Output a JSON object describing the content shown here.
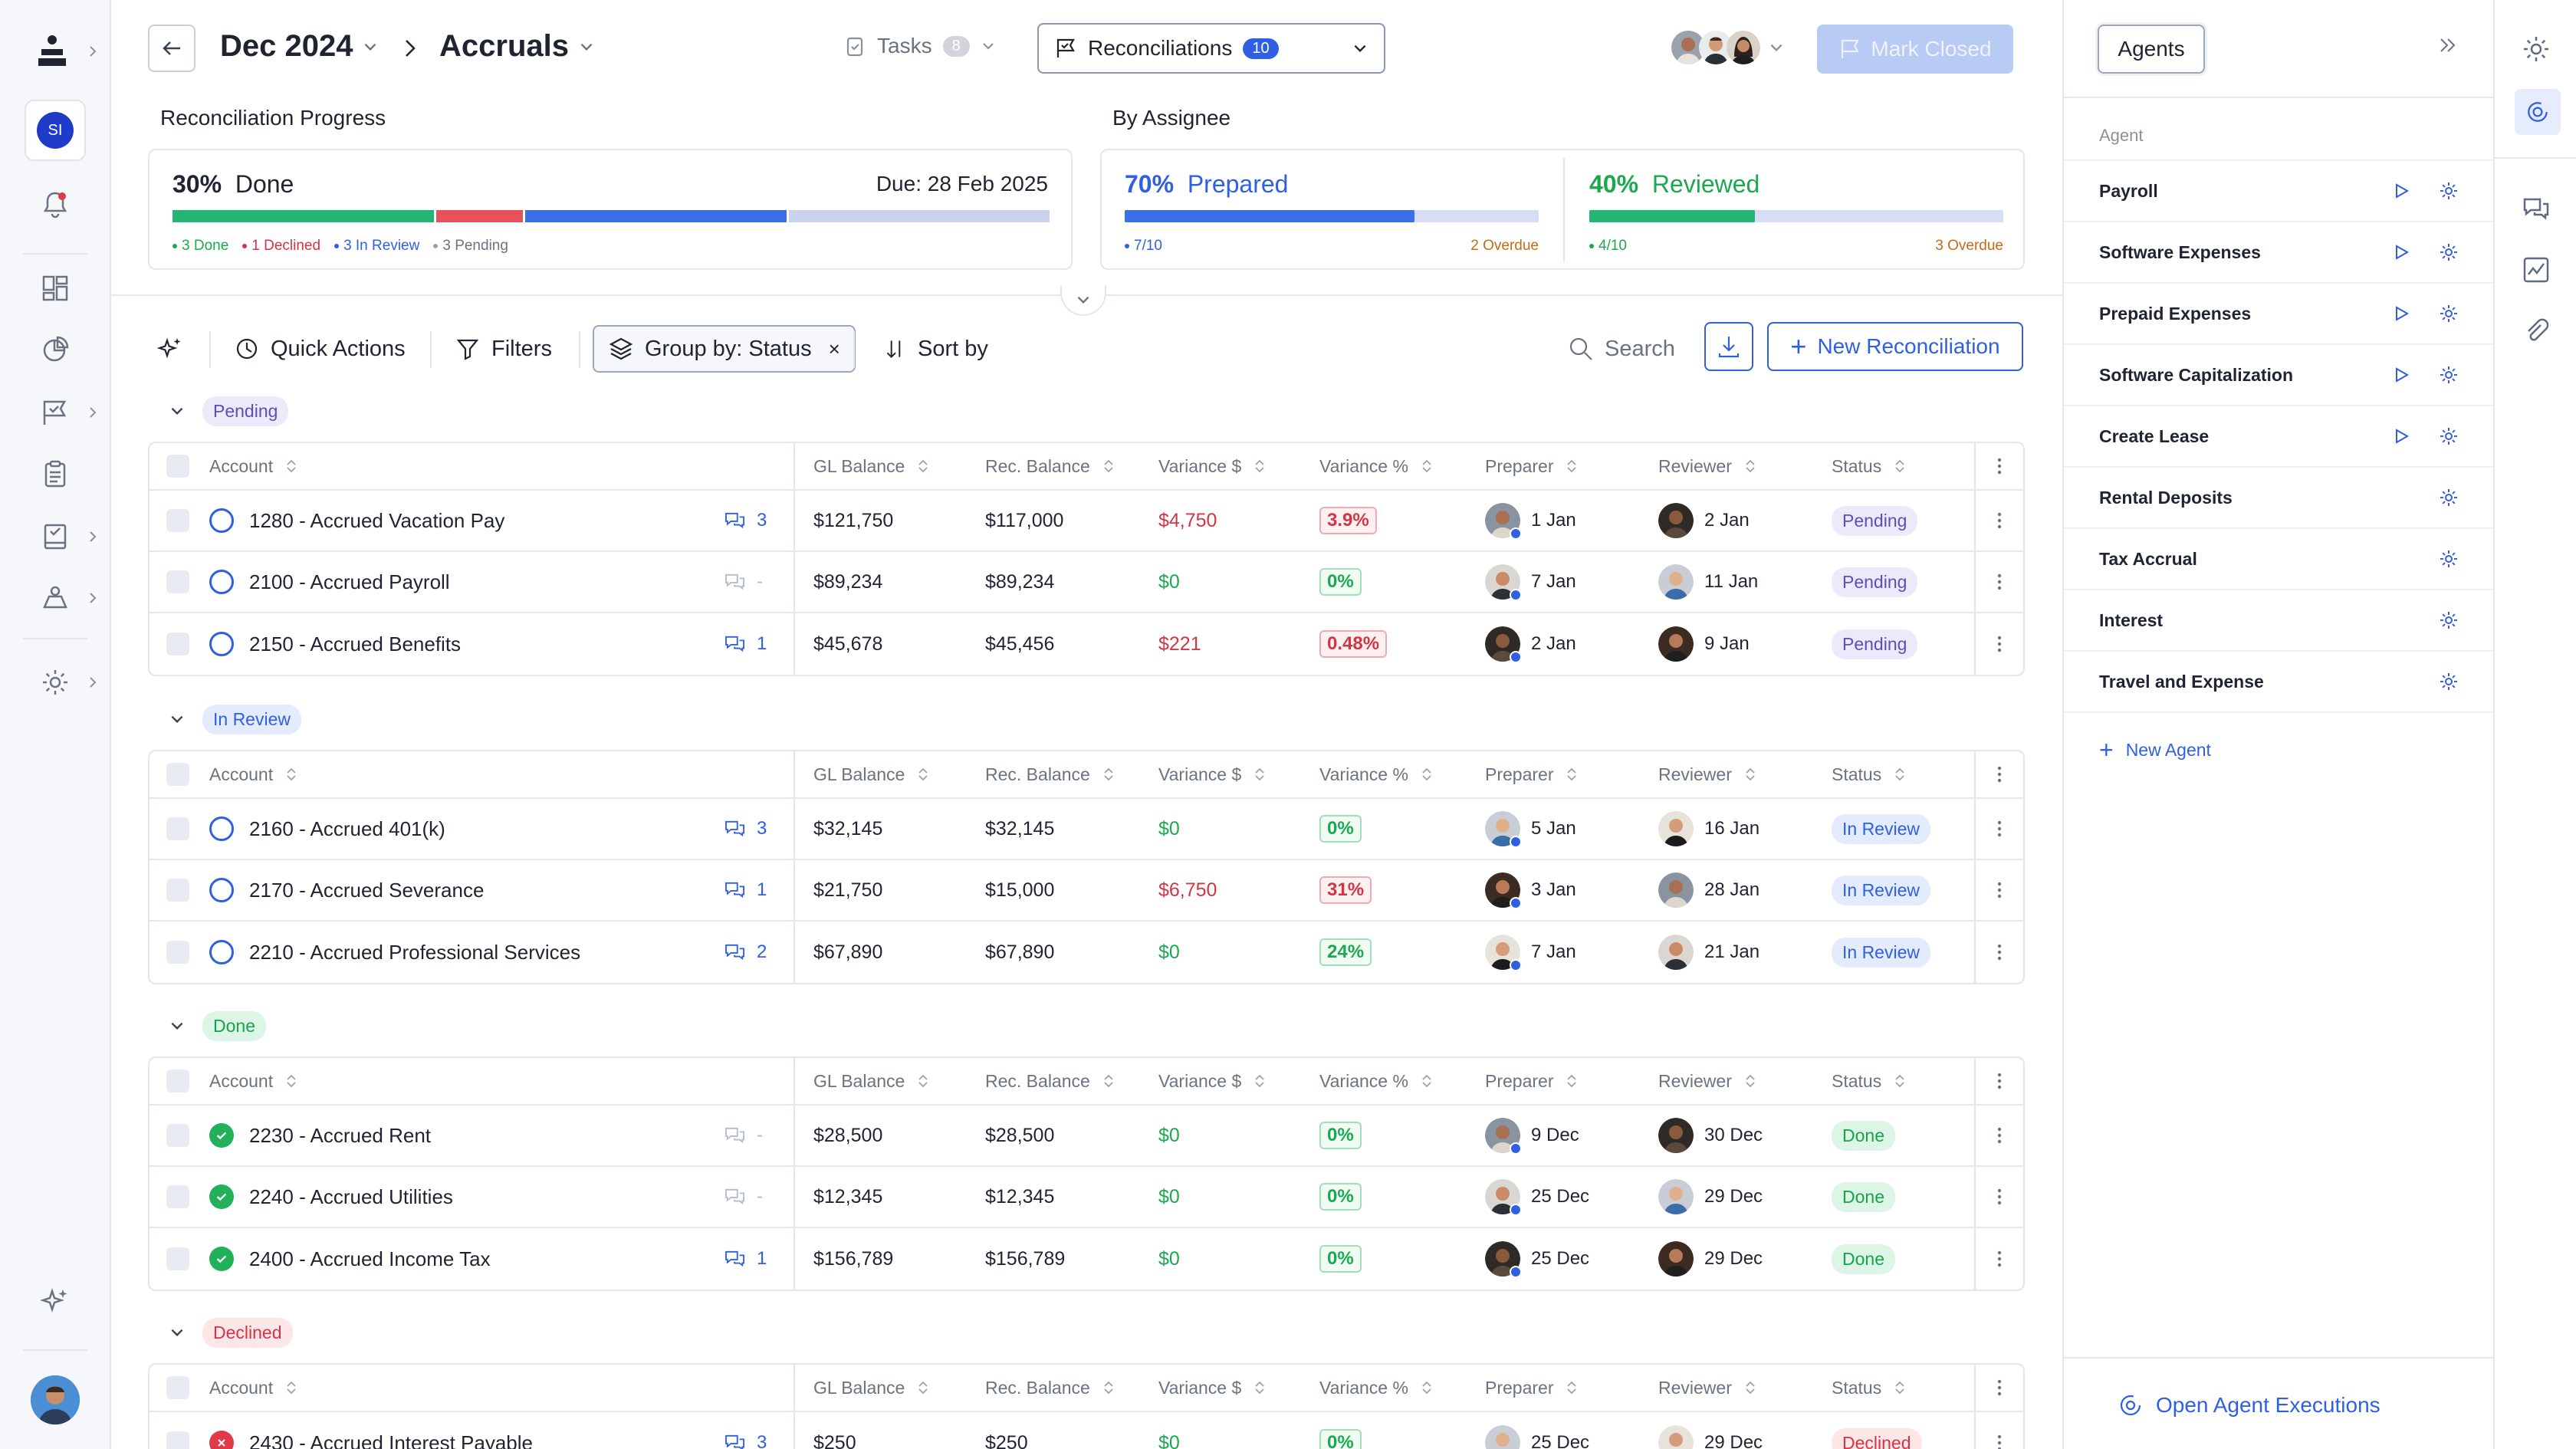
{
  "header": {
    "period": "Dec 2024",
    "section": "Accruals",
    "tasks_label": "Tasks",
    "tasks_count": "8",
    "reconciliations_label": "Reconciliations",
    "reconciliations_count": "10",
    "mark_closed_label": "Mark Closed"
  },
  "progress": {
    "title": "Reconciliation Progress",
    "percent": "30%",
    "label": "Done",
    "due": "Due: 28 Feb 2025",
    "legend": {
      "done": "3 Done",
      "declined": "1 Declined",
      "in_review": "3 In Review",
      "pending": "3 Pending"
    },
    "segments": {
      "done": 3,
      "declined": 1,
      "in_review": 3,
      "pending": 3
    },
    "colors": {
      "done": "#22b573",
      "declined": "#e8505b",
      "in_review": "#3a6fe6",
      "pending": "#c9d3ee"
    }
  },
  "assignee": {
    "title": "By Assignee",
    "prepared": {
      "percent": "70%",
      "label": "Prepared",
      "count": "7/10",
      "overdue": "2 Overdue",
      "fraction": 0.7
    },
    "reviewed": {
      "percent": "40%",
      "label": "Reviewed",
      "count": "4/10",
      "overdue": "3 Overdue",
      "fraction": 0.4
    }
  },
  "toolbar": {
    "quick_actions": "Quick Actions",
    "filters": "Filters",
    "group_by": "Group by: Status",
    "sort_by": "Sort by",
    "search_placeholder": "Search",
    "new_reconciliation": "New Reconciliation"
  },
  "columns": {
    "account": "Account",
    "gl_balance": "GL Balance",
    "rec_balance": "Rec. Balance",
    "variance_amt": "Variance $",
    "variance_pct": "Variance %",
    "preparer": "Preparer",
    "reviewer": "Reviewer",
    "status": "Status"
  },
  "groups": [
    {
      "name": "Pending",
      "rows": [
        {
          "account": "1280 - Accrued Vacation Pay",
          "comments": "3",
          "gl": "$121,750",
          "rec": "$117,000",
          "var": "$4,750",
          "pct": "3.9%",
          "prep": "1 Jan",
          "rev": "2 Jan",
          "status": "Pending"
        },
        {
          "account": "2100 - Accrued Payroll",
          "comments": "-",
          "gl": "$89,234",
          "rec": "$89,234",
          "var": "$0",
          "pct": "0%",
          "prep": "7 Jan",
          "rev": "11 Jan",
          "status": "Pending"
        },
        {
          "account": "2150 - Accrued Benefits",
          "comments": "1",
          "gl": "$45,678",
          "rec": "$45,456",
          "var": "$221",
          "pct": "0.48%",
          "prep": "2 Jan",
          "rev": "9 Jan",
          "status": "Pending"
        }
      ]
    },
    {
      "name": "In Review",
      "rows": [
        {
          "account": "2160 - Accrued 401(k)",
          "comments": "3",
          "gl": "$32,145",
          "rec": "$32,145",
          "var": "$0",
          "pct": "0%",
          "prep": "5 Jan",
          "rev": "16 Jan",
          "status": "In Review"
        },
        {
          "account": "2170 - Accrued Severance",
          "comments": "1",
          "gl": "$21,750",
          "rec": "$15,000",
          "var": "$6,750",
          "pct": "31%",
          "prep": "3 Jan",
          "rev": "28 Jan",
          "status": "In Review"
        },
        {
          "account": "2210 - Accrued Professional Services",
          "comments": "2",
          "gl": "$67,890",
          "rec": "$67,890",
          "var": "$0",
          "pct": "24%",
          "prep": "7 Jan",
          "rev": "21 Jan",
          "status": "In Review"
        }
      ]
    },
    {
      "name": "Done",
      "rows": [
        {
          "account": "2230 - Accrued Rent",
          "comments": "-",
          "gl": "$28,500",
          "rec": "$28,500",
          "var": "$0",
          "pct": "0%",
          "prep": "9 Dec",
          "rev": "30 Dec",
          "status": "Done"
        },
        {
          "account": "2240 - Accrued Utilities",
          "comments": "-",
          "gl": "$12,345",
          "rec": "$12,345",
          "var": "$0",
          "pct": "0%",
          "prep": "25 Dec",
          "rev": "29 Dec",
          "status": "Done"
        },
        {
          "account": "2400 - Accrued Income Tax",
          "comments": "1",
          "gl": "$156,789",
          "rec": "$156,789",
          "var": "$0",
          "pct": "0%",
          "prep": "25 Dec",
          "rev": "29 Dec",
          "status": "Done"
        }
      ]
    },
    {
      "name": "Declined",
      "rows": [
        {
          "account": "2430 - Accrued Interest Payable",
          "comments": "3",
          "gl": "$250",
          "rec": "$250",
          "var": "$0",
          "pct": "0%",
          "prep": "25 Dec",
          "rev": "29 Dec",
          "status": "Declined"
        }
      ]
    }
  ],
  "agents_panel": {
    "tab_label": "Agents",
    "section_label": "Agent",
    "items": [
      {
        "name": "Payroll",
        "runnable": true
      },
      {
        "name": "Software Expenses",
        "runnable": true
      },
      {
        "name": "Prepaid Expenses",
        "runnable": true
      },
      {
        "name": "Software Capitalization",
        "runnable": true
      },
      {
        "name": "Create Lease",
        "runnable": true
      },
      {
        "name": "Rental Deposits",
        "runnable": false
      },
      {
        "name": "Tax Accrual",
        "runnable": false
      },
      {
        "name": "Interest",
        "runnable": false
      },
      {
        "name": "Travel and Expense",
        "runnable": false
      }
    ],
    "new_agent": "New Agent",
    "open_executions": "Open Agent Executions"
  },
  "user": {
    "initials": "SI"
  },
  "colors": {
    "accent": "#2f5fe3",
    "positive": "#1ca84f",
    "negative": "#d33545"
  }
}
